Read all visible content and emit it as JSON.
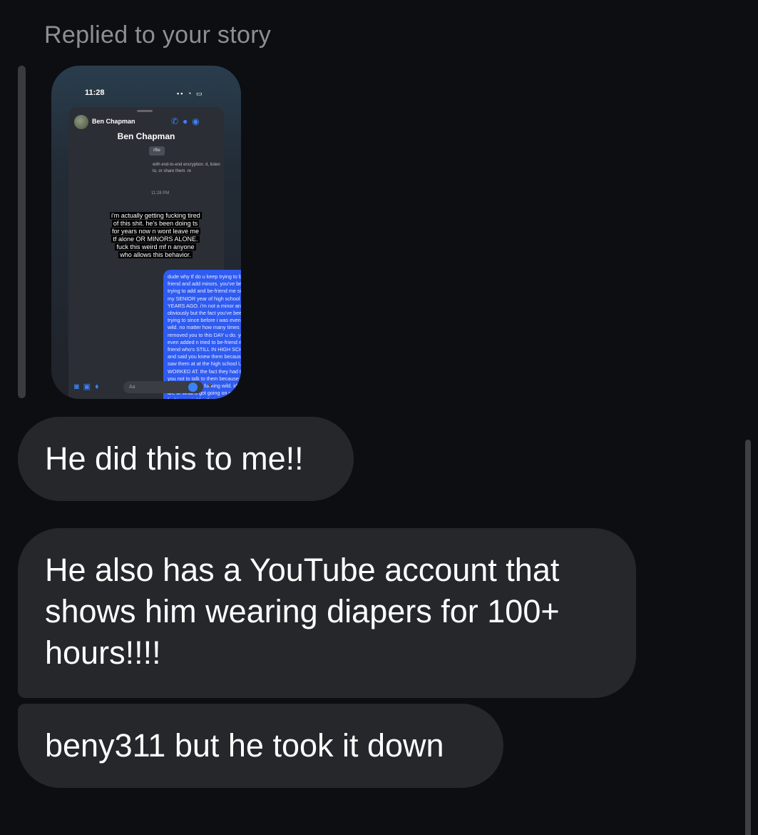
{
  "reply_label": "Replied to your story",
  "story": {
    "phone_time": "11:28",
    "contact_name": "Ben Chapman",
    "header_title": "Ben Chapman",
    "profile_chip": "rfile",
    "encryption_note": "with end-to-end encryption. d, listen to, or share them. re",
    "timestamp": "11:28 PM",
    "caption": "i'm actually getting fucking tired of this shit. he's been doing ts for years now n wont leave me tf alone OR MINORS ALONE. fuck this weird mf n anyone who allows this behavior.",
    "sent_message": "dude why tf do u keep trying to be-friend and add minors. you've been trying to add and be-friend me since my SENIOR year of high school TWO YEARS AGO. i'm not a minor anymore obviously but the fact you've been trying to since before i was even 18 is wild. no matter how many times i've removed you to this DAY u do. you've even added n tried to be-friend my friend who's STILL IN HIGH SCHOOL. and said you knew them because you saw them at at the high school U WORKED AT. the fact they had to tell you not to talk to them because it's inappropriate is fucking wild. idc who u are or what u got going on you're fucking weird for that shit.",
    "composer_placeholder": "Aa"
  },
  "messages": [
    {
      "text": "He did this to me!!"
    },
    {
      "text": "He also has a YouTube account that shows him wearing diapers for 100+ hours!!!!"
    },
    {
      "text": "beny311 but he took it down"
    }
  ],
  "colors": {
    "background": "#0d0e12",
    "bubble": "#26272b",
    "label": "#8e8e93",
    "messenger_blue": "#2f5bf0"
  }
}
